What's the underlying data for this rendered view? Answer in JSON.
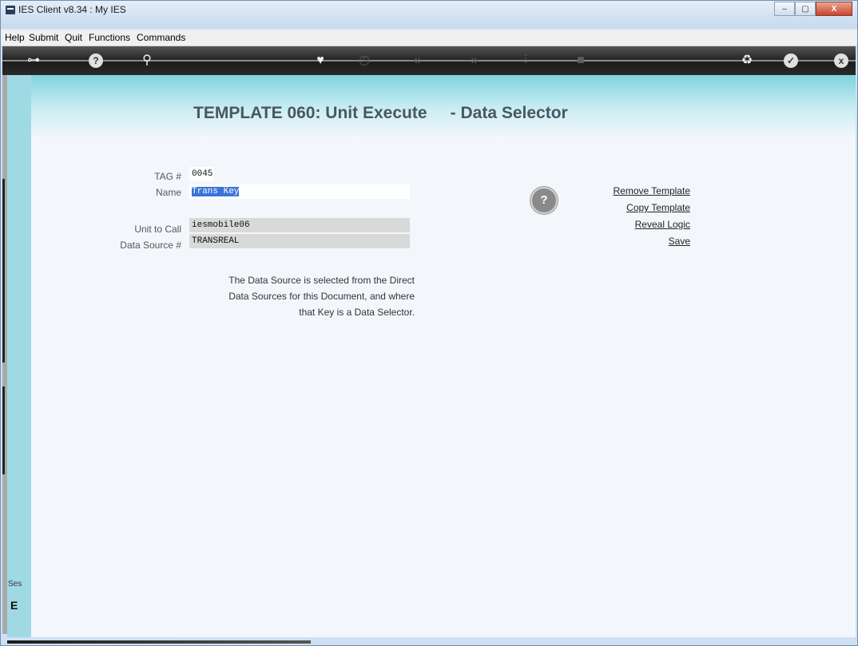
{
  "window": {
    "title": "IES Client v8.34 : My IES",
    "controls": [
      "–",
      "▢",
      "X"
    ]
  },
  "menu": [
    "Help",
    "Submit",
    "Quit",
    "Functions",
    "Commands"
  ],
  "toolbar": {
    "icons": [
      "key-icon",
      "help-icon",
      "search-icon",
      "heart-icon",
      "clock-icon",
      "rewind-icon",
      "forward-icon",
      "tools-icon",
      "stop-icon",
      "recycle-icon",
      "check-icon",
      "close-icon"
    ]
  },
  "page": {
    "heading": "TEMPLATE 060: Unit Execute     - Data Selector",
    "fields": {
      "tag_label": "TAG #",
      "tag_value": "0045",
      "name_label": "Name",
      "name_value": "Trans Key",
      "unit_label": "Unit to Call",
      "unit_value": "iesmobile06",
      "source_label": "Data Source #",
      "source_value": "TRANSREAL"
    },
    "note": [
      "The Data Source is selected from the Direct",
      "Data Sources for this Document, and where",
      "that Key is a Data Selector."
    ],
    "actions": [
      "Remove Template",
      "Copy Template",
      "Reveal Logic",
      "Save"
    ],
    "help_glyph": "?"
  },
  "sidebar": {
    "label": "Ses",
    "glyph": "E"
  },
  "colors": {
    "heading": "#4a5661",
    "selection": "#3a75d9",
    "gradient_top": "#7fd2de"
  }
}
